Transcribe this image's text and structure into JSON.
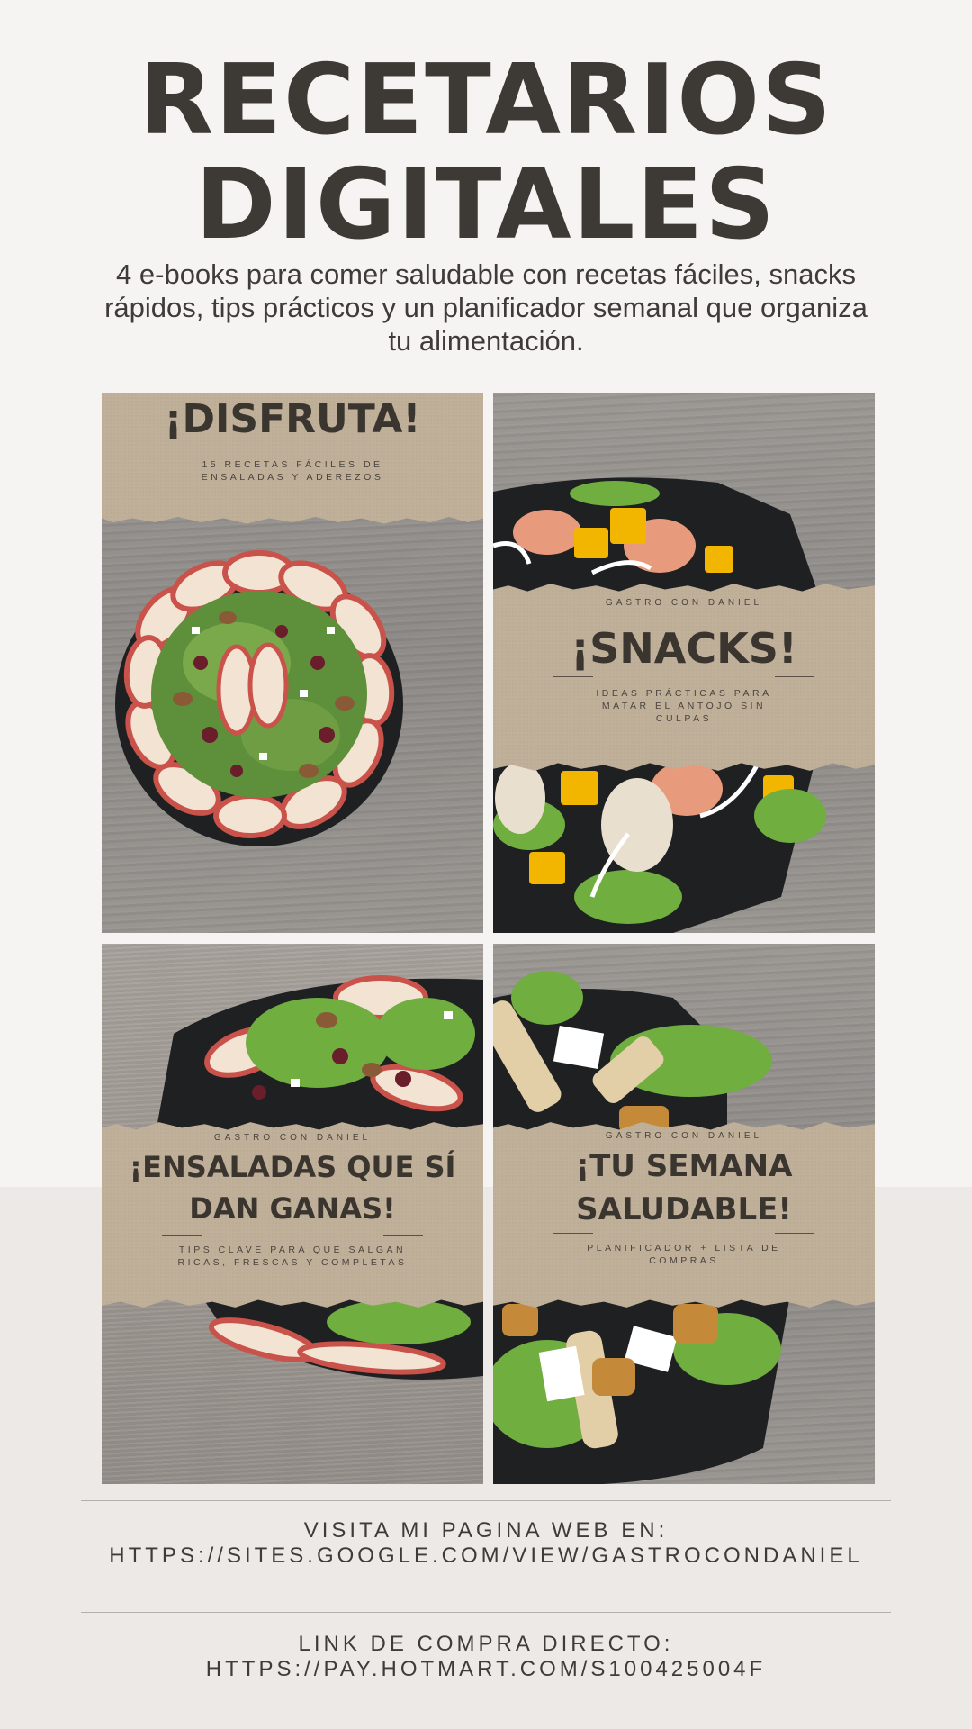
{
  "header": {
    "title_line1": "RECETARIOS",
    "title_line2": "DIGITALES",
    "subtitle": "4 e-books para comer saludable con recetas fáciles, snacks rápidos, tips prácticos y un planificador semanal que organiza tu alimentación."
  },
  "ebooks": [
    {
      "brand": "",
      "title": "¡DISFRUTA!",
      "description": "15 RECETAS FÁCILES DE ENSALADAS Y ADEREZOS"
    },
    {
      "brand": "GASTRO CON DANIEL",
      "title": "¡SNACKS!",
      "description": "IDEAS PRÁCTICAS PARA MATAR EL ANTOJO SIN CULPAS"
    },
    {
      "brand": "GASTRO CON DANIEL",
      "title_line1": "¡ENSALADAS QUE SÍ",
      "title_line2": "DAN GANAS!",
      "description": "TIPS CLAVE PARA QUE SALGAN RICAS, FRESCAS Y COMPLETAS"
    },
    {
      "brand": "GASTRO CON DANIEL",
      "title_line1": "¡TU SEMANA",
      "title_line2": "SALUDABLE!",
      "description": "PLANIFICADOR + LISTA DE COMPRAS"
    }
  ],
  "links": {
    "website_label": "VISITA MI PAGINA WEB EN:",
    "website_url": "HTTPS://SITES.GOOGLE.COM/VIEW/GASTROCONDANIEL",
    "purchase_label": "LINK DE COMPRA DIRECTO:",
    "purchase_url": "HTTPS://PAY.HOTMART.COM/S100425004F"
  },
  "colors": {
    "background": "#f6f4f3",
    "bottom_band": "#ede9e7",
    "kraft_paper": "#c0b09a",
    "title_text": "#3d3934",
    "plate": "#1f2022"
  }
}
